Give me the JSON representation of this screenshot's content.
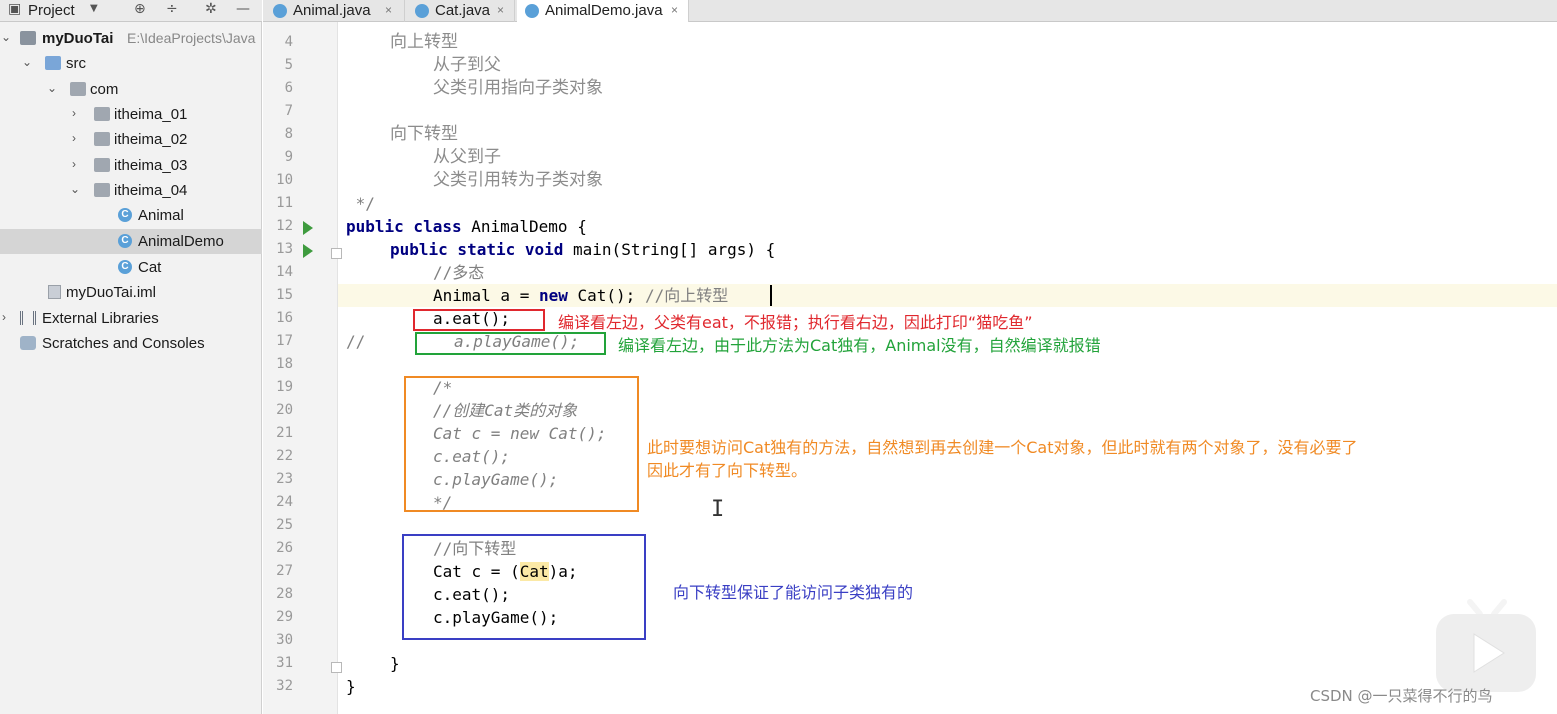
{
  "project_panel": {
    "title": "Project",
    "tree": [
      {
        "label": "myDuoTai",
        "path": "E:\\IdeaProjects\\Java",
        "type": "project",
        "arrow": "down"
      },
      {
        "label": "src",
        "type": "folder-blue",
        "arrow": "down"
      },
      {
        "label": "com",
        "type": "folder",
        "arrow": "down"
      },
      {
        "label": "itheima_01",
        "type": "folder",
        "arrow": "right"
      },
      {
        "label": "itheima_02",
        "type": "folder",
        "arrow": "right"
      },
      {
        "label": "itheima_03",
        "type": "folder",
        "arrow": "right"
      },
      {
        "label": "itheima_04",
        "type": "folder",
        "arrow": "down"
      },
      {
        "label": "Animal",
        "type": "class"
      },
      {
        "label": "AnimalDemo",
        "type": "class",
        "selected": true
      },
      {
        "label": "Cat",
        "type": "class"
      },
      {
        "label": "myDuoTai.iml",
        "type": "file"
      },
      {
        "label": "External Libraries",
        "type": "lib",
        "arrow": "right"
      },
      {
        "label": "Scratches and Consoles",
        "type": "scratch"
      }
    ]
  },
  "tabs": [
    {
      "label": "Animal.java",
      "close": "×",
      "active": false
    },
    {
      "label": "Cat.java",
      "close": "×",
      "active": false
    },
    {
      "label": "AnimalDemo.java",
      "close": "×",
      "active": true
    }
  ],
  "editor": {
    "line_numbers": [
      "4",
      "5",
      "6",
      "7",
      "8",
      "9",
      "10",
      "11",
      "12",
      "13",
      "14",
      "15",
      "16",
      "17",
      "18",
      "19",
      "20",
      "21",
      "22",
      "23",
      "24",
      "25",
      "26",
      "27",
      "28",
      "29",
      "30",
      "31",
      "32"
    ],
    "lines": {
      "l4": "向上转型",
      "l5": "从子到父",
      "l6": "父类引用指向子类对象",
      "l8": "向下转型",
      "l9": "从父到子",
      "l10": "父类引用转为子类对象",
      "l11": " */",
      "l12_kw": "public class",
      "l12_rest": " AnimalDemo {",
      "l13_kw": "public static void",
      "l13_rest": " main(String[] args) {",
      "l14": "//多态",
      "l15_a": "Animal a = ",
      "l15_kw": "new",
      "l15_b": " Cat(); ",
      "l15_cmt": "//向上转型",
      "l16": "a.eat();",
      "l17_cmt": "//",
      "l17_code": "a.playGame();",
      "l19": "/*",
      "l20": "//创建Cat类的对象",
      "l21": "Cat c = new Cat();",
      "l22": "c.eat();",
      "l23": "c.playGame();",
      "l24": "*/",
      "l26": "//向下转型",
      "l27_a": "Cat c = (",
      "l27_hl": "Cat",
      "l27_b": ")a;",
      "l28": "c.eat();",
      "l29": "c.playGame();",
      "l31": "}",
      "l32": "}"
    }
  },
  "annotations": {
    "red_note": "编译看左边，父类有eat，不报错；执行看右边，因此打印“猫吃鱼”",
    "green_note": "编译看左边，由于此方法为Cat独有，Animal没有，自然编译就报错",
    "orange_note_1": "此时要想访问Cat独有的方法，自然想到再去创建一个Cat对象，但此时就有两个对象了，没有必要了",
    "orange_note_2": "因此才有了向下转型。",
    "blue_note": "向下转型保证了能访问子类独有的"
  },
  "colors": {
    "red": "#e0282e",
    "green": "#22a33a",
    "orange": "#f08a24",
    "blue": "#3a3fc4"
  },
  "watermark": "CSDN @一只菜得不行的鸟"
}
